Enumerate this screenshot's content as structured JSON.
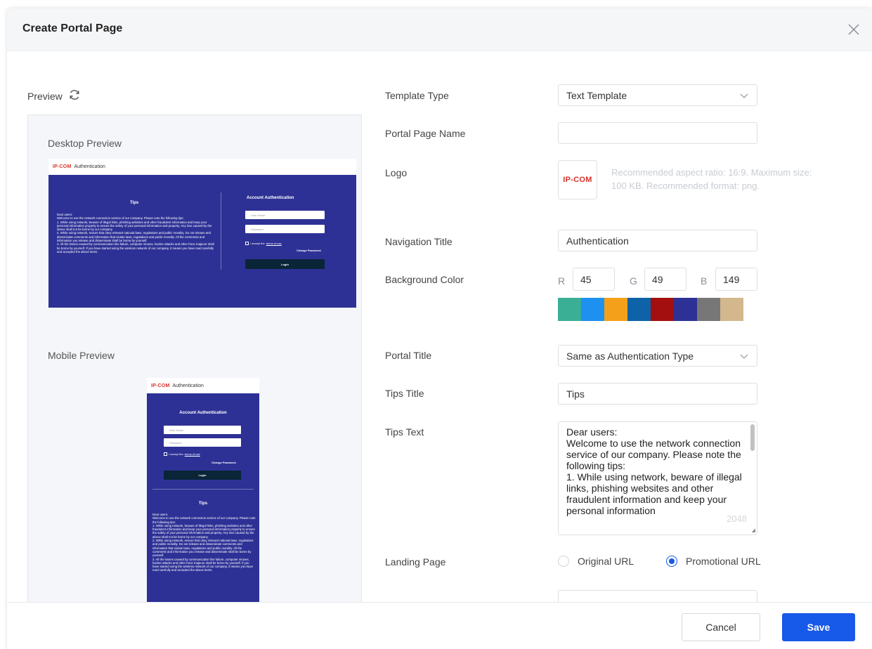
{
  "dialog": {
    "title": "Create Portal Page",
    "cancel_label": "Cancel",
    "save_label": "Save"
  },
  "preview": {
    "label": "Preview",
    "desktop_label": "Desktop Preview",
    "mobile_label": "Mobile Preview",
    "logo": "IP-COM",
    "nav_title": "Authentication",
    "tips_title": "Tips",
    "tips_text": "Dear users:\nWelcome to use the network connection service of our company. Please note the following tips:\n1. While using network, beware of illegal links, phishing websites and other fraudulent information and keep your personal information properly to ensure the safety of your personal information and property. Any loss caused by the above shall not be borne by our company.\n2. While using network, ensure that obey relevant national laws, regulations and public morality. Do not release and disseminate comments and information that violate laws, regulations and public morality. All the comments and information you release and disseminate shall be borne by yourself.\n3. All the losses caused by communication line failure, computer viruses, hacker attacks and other force majeure shall be borne by yourself. If you have started using the wireless network of our company, it means you have read carefully and accepted the above items.",
    "account_title": "Account Authentication",
    "username_placeholder": "User Name",
    "password_placeholder": "Password",
    "agree_text": "I accept the",
    "terms_text": "terms of use",
    "change_password": "Change Password",
    "login_label": "Login"
  },
  "form": {
    "template_type": {
      "label": "Template Type",
      "value": "Text Template"
    },
    "portal_page_name": {
      "label": "Portal Page Name",
      "value": ""
    },
    "logo": {
      "label": "Logo",
      "image_text": "IP-COM",
      "hint": "Recommended aspect ratio: 16:9. Maximum size: 100 KB. Recommended format: png."
    },
    "navigation_title": {
      "label": "Navigation Title",
      "value": "Authentication"
    },
    "background_color": {
      "label": "Background Color",
      "r_label": "R",
      "r": "45",
      "g_label": "G",
      "g": "49",
      "b_label": "B",
      "b": "149",
      "swatches": [
        "#3aaf95",
        "#1e90f0",
        "#f5a01a",
        "#0d62a8",
        "#a30e0e",
        "#2d3195",
        "#777777",
        "#d2b88c"
      ]
    },
    "portal_title": {
      "label": "Portal Title",
      "value": "Same as Authentication Type"
    },
    "tips_title": {
      "label": "Tips Title",
      "value": "Tips"
    },
    "tips_text": {
      "label": "Tips Text",
      "value": "Dear users:\nWelcome to use the network connection service of our company. Please note the following tips:\n1. While using network, beware of illegal links, phishing websites and other fraudulent information and keep your personal information",
      "counter": "2048"
    },
    "landing_page": {
      "label": "Landing Page",
      "option_original": "Original URL",
      "option_promotional": "Promotional URL",
      "selected": "Promotional URL"
    },
    "promotional_url": {
      "value": ""
    }
  }
}
